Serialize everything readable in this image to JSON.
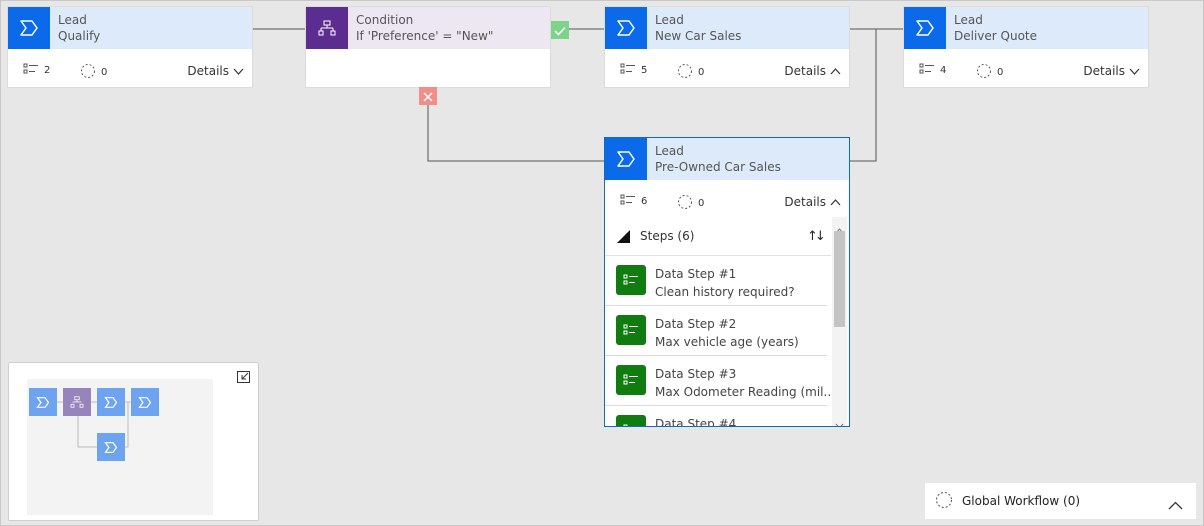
{
  "flow": {
    "qualify": {
      "type": "Lead",
      "name": "Qualify",
      "steps": "2",
      "workflows": "0",
      "details": "Details"
    },
    "condition": {
      "type": "Condition",
      "expression": "If 'Preference' = \"New\""
    },
    "new_car": {
      "type": "Lead",
      "name": "New Car Sales",
      "steps": "5",
      "workflows": "0",
      "details": "Details"
    },
    "deliver": {
      "type": "Lead",
      "name": "Deliver Quote",
      "steps": "4",
      "workflows": "0",
      "details": "Details"
    },
    "preowned": {
      "type": "Lead",
      "name": "Pre-Owned Car Sales",
      "steps": "6",
      "workflows": "0",
      "details": "Details",
      "steps_header": "Steps (6)",
      "step_list": [
        {
          "title": "Data Step #1",
          "field": "Clean history required?"
        },
        {
          "title": "Data Step #2",
          "field": "Max vehicle age (years)"
        },
        {
          "title": "Data Step #3",
          "field": "Max Odometer Reading (mil..."
        },
        {
          "title": "Data Step #4",
          "field": ""
        }
      ]
    }
  },
  "global_workflow": {
    "label": "Global Workflow (0)"
  },
  "icons": {
    "stage": "stage-chevron-icon",
    "condition": "condition-branch-icon",
    "steps": "steps-list-icon",
    "workflow": "workflow-dashed-circle-icon",
    "yes": "checkmark-icon",
    "no": "close-icon"
  },
  "colors": {
    "stage_header": "#ddeafa",
    "stage_icon": "#0b6ae9",
    "condition_header": "#ede7f2",
    "condition_icon": "#5c2d91",
    "step_icon": "#107c10",
    "yes_badge": "#7ed38a",
    "no_badge": "#f08f8a",
    "selected_border": "#0f6cbd"
  }
}
